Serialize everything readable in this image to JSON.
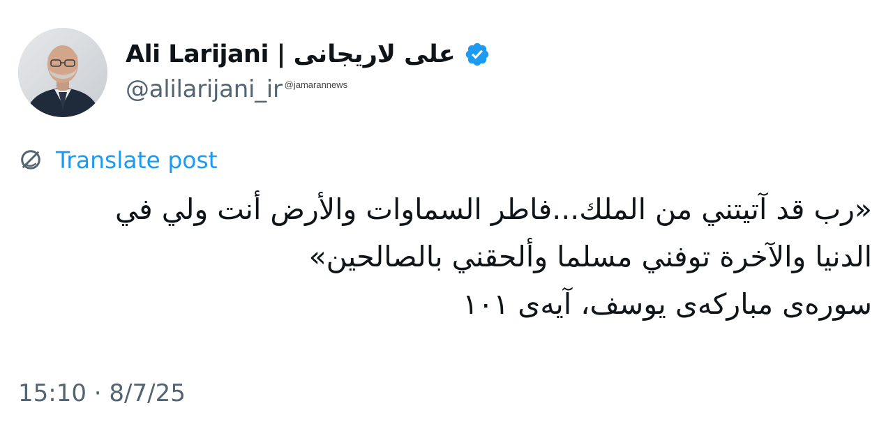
{
  "author": {
    "display_name": "Ali Larijani | علی لاریجانی",
    "handle": "@alilarijani_ir",
    "verified": true,
    "avatar_icon": "profile-photo"
  },
  "watermark": "@jamarannews",
  "translate_label": "Translate post",
  "post": {
    "lines": [
      "«رب قد آتيتني من الملك...فاطر السماوات والأرض أنت ولي في",
      "الدنيا والآخرة توفني مسلما وألحقني بالصالحين»",
      "سوره‌ی مبارکه‌ی یوسف، آیه‌ی ۱۰۱"
    ]
  },
  "timestamp": "15:10 · 8/7/25",
  "colors": {
    "link": "#1d9bf0",
    "secondary_text": "#536471",
    "primary_text": "#0f1419",
    "verified_badge": "#1d9bf0"
  }
}
